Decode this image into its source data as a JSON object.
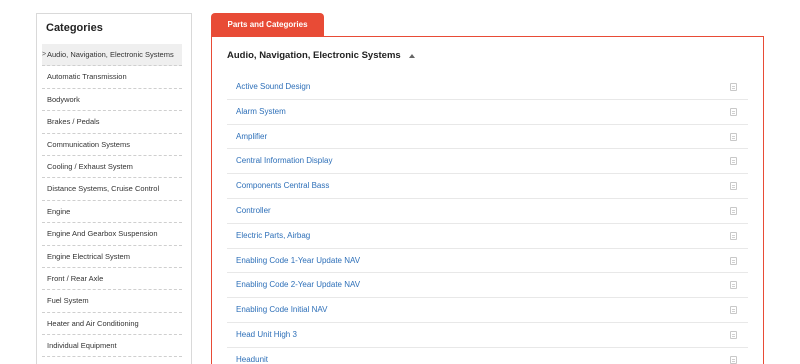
{
  "sidebar": {
    "title": "Categories",
    "active_marker": ">",
    "items": [
      {
        "label": "Audio, Navigation, Electronic Systems"
      },
      {
        "label": "Automatic Transmission"
      },
      {
        "label": "Bodywork"
      },
      {
        "label": "Brakes / Pedals"
      },
      {
        "label": "Communication Systems"
      },
      {
        "label": "Cooling / Exhaust System"
      },
      {
        "label": "Distance Systems, Cruise Control"
      },
      {
        "label": "Engine"
      },
      {
        "label": "Engine And Gearbox Suspension"
      },
      {
        "label": "Engine Electrical System"
      },
      {
        "label": "Front / Rear Axle"
      },
      {
        "label": "Fuel System"
      },
      {
        "label": "Heater and Air Conditioning"
      },
      {
        "label": "Individual Equipment"
      }
    ]
  },
  "tab": {
    "label": "Parts and Categories"
  },
  "panel": {
    "header": "Audio, Navigation, Electronic Systems",
    "parts": [
      {
        "label": "Active Sound Design"
      },
      {
        "label": "Alarm System"
      },
      {
        "label": "Amplifier"
      },
      {
        "label": "Central Information Display"
      },
      {
        "label": "Components Central Bass"
      },
      {
        "label": "Controller"
      },
      {
        "label": "Electric Parts, Airbag"
      },
      {
        "label": "Enabling Code 1-Year Update NAV"
      },
      {
        "label": "Enabling Code 2-Year Update NAV"
      },
      {
        "label": "Enabling Code Initial NAV"
      },
      {
        "label": "Head Unit High 3"
      },
      {
        "label": "Headunit"
      }
    ]
  },
  "colors": {
    "accent": "#e84b36",
    "link": "#2d6fb8"
  },
  "icons": {
    "header_toggle": "caret-up-icon",
    "row_icon": "document-icon"
  }
}
